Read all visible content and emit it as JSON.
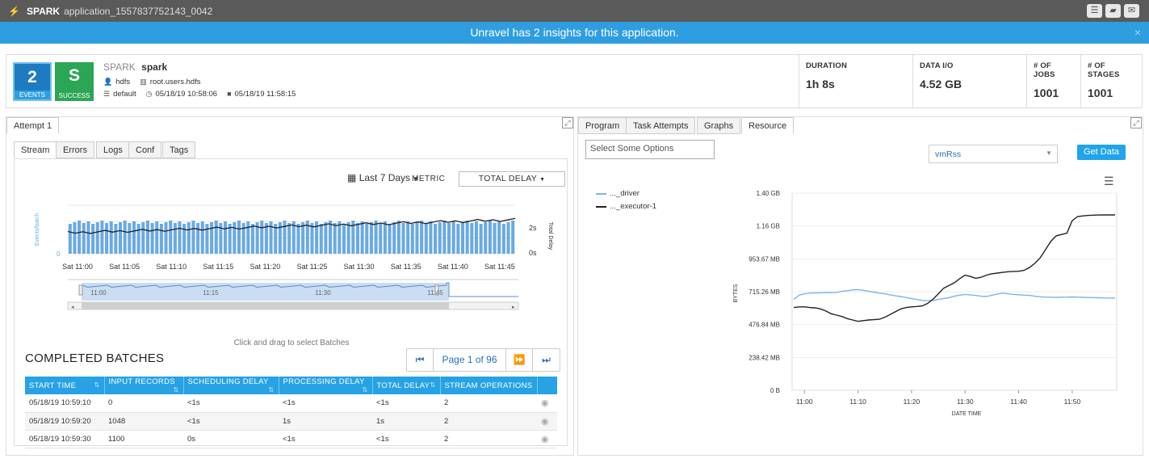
{
  "titlebar": {
    "app_type": "SPARK",
    "app_id": "application_1557837752143_0042",
    "logo_icon": "lightning-icon",
    "icons": [
      "list-icon",
      "chat-icon",
      "comment-icon"
    ]
  },
  "banner": {
    "text": "Unravel has 2 insights for this application.",
    "close": "×"
  },
  "summary": {
    "events": {
      "count": "2",
      "label": "EVENTS"
    },
    "status": {
      "letter": "S",
      "label": "SUCCESS"
    },
    "app_type": "SPARK",
    "app_name": "spark",
    "user": "hdfs",
    "queue": "root.users.hdfs",
    "database": "default",
    "start_time": "05/18/19 10:58:06",
    "end_time": "05/18/19 11:58:15",
    "stats": [
      {
        "label": "DURATION",
        "value": "1h 8s"
      },
      {
        "label": "DATA I/O",
        "value": "4.52 GB"
      },
      {
        "label": "# OF JOBS",
        "value": "1001"
      },
      {
        "label": "# OF STAGES",
        "value": "1001"
      }
    ]
  },
  "left": {
    "attempt_tab": "Attempt 1",
    "tabs": [
      "Stream",
      "Errors",
      "Logs",
      "Conf",
      "Tags"
    ],
    "date_range": "Last 7 Days",
    "metric_label": "METRIC",
    "metric_value": "TOTAL DELAY",
    "hint": "Click and drag to select Batches",
    "completed_title": "COMPLETED BATCHES",
    "pager": {
      "first": "⏮",
      "prev": "◀",
      "label": "Page 1 of 96",
      "next": "▶",
      "last": "⏭"
    },
    "table": {
      "headers": [
        "START TIME",
        "INPUT RECORDS",
        "SCHEDULING DELAY",
        "PROCESSING DELAY",
        "TOTAL DELAY",
        "STREAM OPERATIONS"
      ],
      "rows": [
        [
          "05/18/19 10:59:10",
          "0",
          "<1s",
          "<1s",
          "<1s",
          "2"
        ],
        [
          "05/18/19 10:59:20",
          "1048",
          "<1s",
          "1s",
          "1s",
          "2"
        ],
        [
          "05/18/19 10:59:30",
          "1100",
          "0s",
          "<1s",
          "<1s",
          "2"
        ]
      ]
    }
  },
  "stream_chart": {
    "y_left_label": "Events/batch",
    "y_left_tick": "0",
    "y_right_label": "Total Delay",
    "y_right_ticks": [
      "2s",
      "0s"
    ],
    "x_ticks": [
      "Sat 11:00",
      "Sat 11:05",
      "Sat 11:10",
      "Sat 11:15",
      "Sat 11:20",
      "Sat 11:25",
      "Sat 11:30",
      "Sat 11:35",
      "Sat 11:40",
      "Sat 11:45"
    ],
    "navigator_ticks": [
      "11:00",
      "11:15",
      "11:30",
      "11:45"
    ]
  },
  "right": {
    "tabs": [
      "Program",
      "Task Attempts",
      "Graphs",
      "Resource"
    ],
    "options_placeholder": "Select Some Options",
    "metric_select": "vmRss",
    "get_data": "Get Data",
    "menu_icon": "hamburger-icon"
  },
  "chart_data": {
    "type": "line",
    "title": "",
    "xlabel": "DATE TIME",
    "ylabel": "BYTES",
    "x": [
      "10:58",
      "10:59",
      "11:00",
      "11:01",
      "11:02",
      "11:03",
      "11:04",
      "11:05",
      "11:06",
      "11:07",
      "11:08",
      "11:09",
      "11:10",
      "11:11",
      "11:12",
      "11:13",
      "11:14",
      "11:15",
      "11:16",
      "11:17",
      "11:18",
      "11:19",
      "11:20",
      "11:21",
      "11:22",
      "11:23",
      "11:24",
      "11:25",
      "11:26",
      "11:27",
      "11:28",
      "11:29",
      "11:30",
      "11:31",
      "11:32",
      "11:33",
      "11:34",
      "11:35",
      "11:36",
      "11:37",
      "11:38",
      "11:39",
      "11:40",
      "11:41",
      "11:42",
      "11:43",
      "11:44",
      "11:45",
      "11:46",
      "11:47",
      "11:48",
      "11:49",
      "11:50",
      "11:51",
      "11:52",
      "11:53",
      "11:54",
      "11:55",
      "11:56",
      "11:57",
      "11:58"
    ],
    "x_ticks": [
      "11:00",
      "11:10",
      "11:20",
      "11:30",
      "11:40",
      "11:50"
    ],
    "y_ticks": [
      "0 B",
      "238.42 MB",
      "476.84 MB",
      "715.26 MB",
      "953.67 MB",
      "1.16 GB",
      "1.40 GB"
    ],
    "ylim_mb": [
      0,
      1430
    ],
    "series": [
      {
        "name": "..._driver",
        "color": "#7cb5ec",
        "values": [
          660,
          690,
          700,
          705,
          706,
          707,
          708,
          708,
          710,
          718,
          722,
          728,
          730,
          725,
          718,
          712,
          705,
          700,
          692,
          685,
          680,
          672,
          665,
          658,
          652,
          650,
          652,
          658,
          665,
          672,
          682,
          690,
          695,
          692,
          688,
          682,
          680,
          690,
          698,
          705,
          700,
          695,
          693,
          690,
          688,
          682,
          678,
          676,
          675,
          674,
          675,
          676,
          677,
          676,
          674,
          673,
          672,
          671,
          670,
          669,
          668
        ]
      },
      {
        "name": "..._executor-1",
        "color": "#222222",
        "values": [
          600,
          605,
          605,
          600,
          598,
          590,
          575,
          555,
          545,
          535,
          520,
          510,
          500,
          505,
          510,
          512,
          515,
          530,
          550,
          570,
          590,
          600,
          605,
          608,
          612,
          630,
          660,
          700,
          740,
          760,
          780,
          810,
          835,
          825,
          812,
          820,
          835,
          845,
          850,
          855,
          860,
          862,
          863,
          870,
          890,
          920,
          960,
          1020,
          1080,
          1120,
          1130,
          1140,
          1230,
          1260,
          1265,
          1268,
          1270,
          1271,
          1272,
          1272,
          1272
        ]
      }
    ]
  }
}
